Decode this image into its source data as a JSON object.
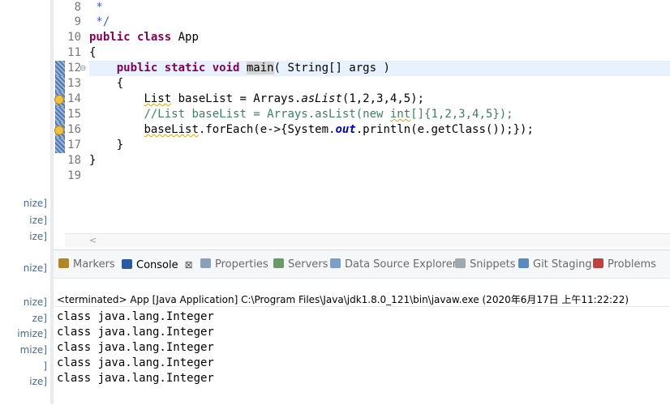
{
  "sidebar_fragments": [
    "nize]",
    "ize]",
    "ize]",
    "nize]",
    "nize]",
    "ze]",
    "imize]",
    "mize]",
    "]",
    "ize]"
  ],
  "editor": {
    "line_numbers": [
      "8",
      "9",
      "10",
      "11",
      "12",
      "13",
      "14",
      "15",
      "16",
      "17",
      "18",
      "19"
    ],
    "lines": {
      "l8": " *",
      "l9": " */",
      "l10_kw": "public class",
      "l10_rest": " App",
      "l11": "{",
      "l12_indent": "    ",
      "l12_kw": "public static void",
      "l12_method": "main",
      "l12_rest": "( String[] args )",
      "l13": "    {",
      "l14_indent": "        ",
      "l14_a": "List",
      "l14_b": " baseList = Arrays.",
      "l14_c": "asList",
      "l14_d": "(1,2,3,4,5);",
      "l15_indent": "        ",
      "l15_a": "//List baseList = Arrays.asList(new ",
      "l15_b": "int",
      "l15_c": "[]{1,2,3,4,5});",
      "l16_indent": "        ",
      "l16_a": "baseList",
      "l16_b": ".forEach(e->{System.",
      "l16_c": "out",
      "l16_d": ".println(e.getClass());});",
      "l17": "    }",
      "l18": "}",
      "l19": ""
    }
  },
  "scroll": {
    "left_arrow": "<"
  },
  "tabs": [
    {
      "label": "Markers",
      "icon": "markers-icon",
      "color": "#b0862a"
    },
    {
      "label": "Console",
      "icon": "console-icon",
      "color": "#2a5a9a",
      "active": true,
      "close": "⊠"
    },
    {
      "label": "Properties",
      "icon": "properties-icon",
      "color": "#8aa0b8"
    },
    {
      "label": "Servers",
      "icon": "servers-icon",
      "color": "#6a9a6a"
    },
    {
      "label": "Data Source Explorer",
      "icon": "data-source-icon",
      "color": "#7aa0c8"
    },
    {
      "label": "Snippets",
      "icon": "snippets-icon",
      "color": "#a0a8b0"
    },
    {
      "label": "Git Staging",
      "icon": "git-staging-icon",
      "color": "#5a8ac0"
    },
    {
      "label": "Problems",
      "icon": "problems-icon",
      "color": "#c04040"
    }
  ],
  "console": {
    "status": "<terminated> App [Java Application] C:\\Program Files\\Java\\jdk1.8.0_121\\bin\\javaw.exe (2020年6月17日 上午11:22:22)",
    "output": [
      "class java.lang.Integer",
      "class java.lang.Integer",
      "class java.lang.Integer",
      "class java.lang.Integer",
      "class java.lang.Integer"
    ]
  }
}
